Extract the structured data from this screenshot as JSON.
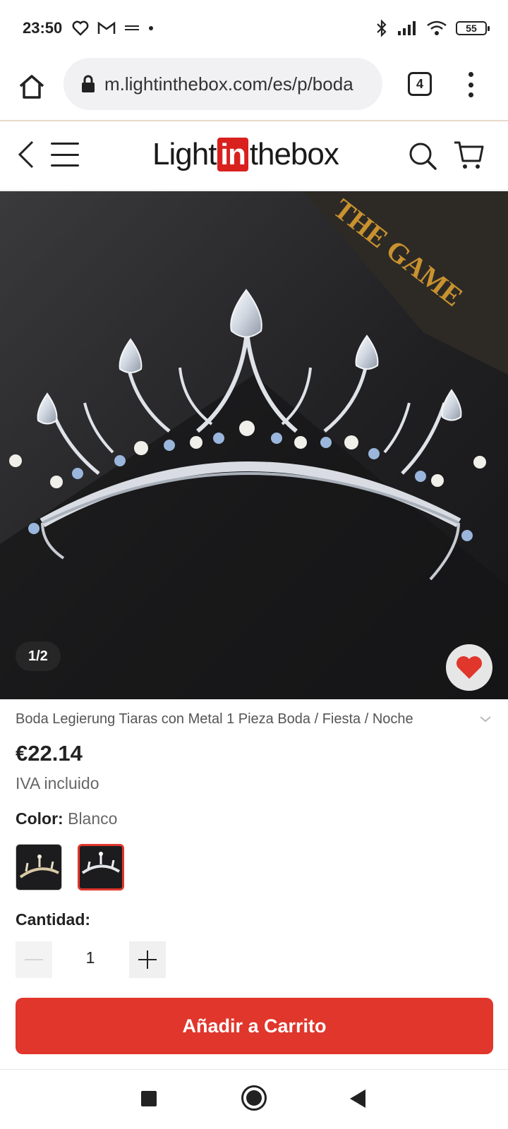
{
  "status_bar": {
    "time": "23:50",
    "left_icons": [
      "heart-icon",
      "gmail-icon",
      "abc-icon"
    ],
    "right_icons": [
      "bluetooth-icon",
      "signal-icon",
      "wifi-icon"
    ],
    "battery": "55"
  },
  "browser": {
    "url": "m.lightinthebox.com/es/p/boda",
    "tab_count": "4"
  },
  "site": {
    "logo_before": "Light",
    "logo_in": "in",
    "logo_after": "thebox"
  },
  "gallery": {
    "counter": "1/2",
    "watermark_text": "THE GAME"
  },
  "product": {
    "title": "Boda Legierung Tiaras con Metal 1 Pieza Boda / Fiesta / Noche",
    "price": "€22.14",
    "vat": "IVA incluido",
    "color_label": "Color:",
    "color_value": "Blanco",
    "quantity_label": "Cantidad:",
    "quantity_value": "1",
    "add_to_cart": "Añadir a Carrito"
  },
  "colors": {
    "accent": "#e0362c",
    "logo_red": "#d9211e",
    "image_bg": "#2b2b2d"
  }
}
